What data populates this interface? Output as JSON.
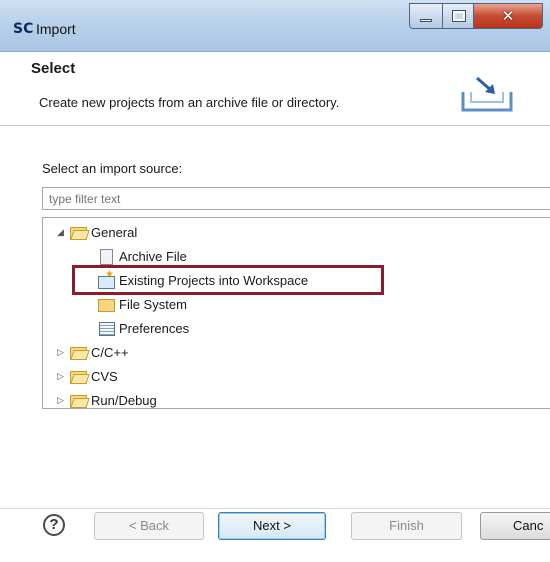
{
  "window": {
    "logo": "SC",
    "title": "Import"
  },
  "header": {
    "title": "Select",
    "description": "Create new projects from an archive file or directory."
  },
  "body": {
    "section_label": "Select an import source:",
    "filter_placeholder": "type filter text"
  },
  "tree": {
    "items": [
      {
        "label": "General",
        "expanded": true,
        "icon": "folder-open-icon"
      },
      {
        "label": "Archive File",
        "icon": "archive-file-icon"
      },
      {
        "label": "Existing Projects into Workspace",
        "icon": "existing-projects-icon",
        "highlighted": true
      },
      {
        "label": "File System",
        "icon": "file-system-icon"
      },
      {
        "label": "Preferences",
        "icon": "preferences-icon"
      },
      {
        "label": "C/C++",
        "expanded": false,
        "icon": "folder-icon"
      },
      {
        "label": "CVS",
        "expanded": false,
        "icon": "folder-icon"
      },
      {
        "label": "Run/Debug",
        "expanded": false,
        "icon": "folder-icon"
      }
    ]
  },
  "buttons": {
    "help": "?",
    "back": "< Back",
    "next": "Next >",
    "finish": "Finish",
    "cancel": "Canc"
  },
  "colors": {
    "highlight_border": "#8a1c2b",
    "titlebar": "#b9d1ea",
    "close_button": "#c74c33"
  }
}
